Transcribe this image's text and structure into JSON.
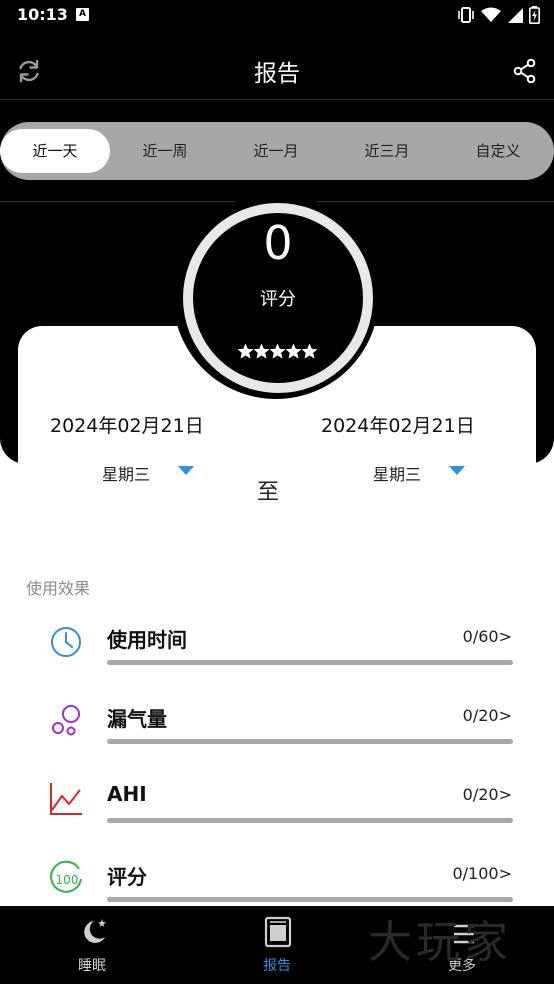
{
  "status_bar": {
    "time": "10:13",
    "notification_letter": "A"
  },
  "header": {
    "title": "报告"
  },
  "tabs": [
    {
      "label": "近一天",
      "active": true
    },
    {
      "label": "近一周",
      "active": false
    },
    {
      "label": "近一月",
      "active": false
    },
    {
      "label": "近三月",
      "active": false
    },
    {
      "label": "自定义",
      "active": false
    }
  ],
  "score": {
    "value": "0",
    "label": "评分",
    "stars_total": 5,
    "stars_filled": 5
  },
  "date_range": {
    "start_date": "2024年02月21日",
    "start_weekday": "星期三",
    "end_date": "2024年02月21日",
    "end_weekday": "星期三",
    "separator": "至"
  },
  "section": {
    "title": "使用效果"
  },
  "metrics": [
    {
      "name": "使用时间",
      "value": "0/60>",
      "progress": 0,
      "icon": "clock-icon",
      "color": "#2f8fe0"
    },
    {
      "name": "漏气量",
      "value": "0/20>",
      "progress": 0,
      "icon": "bubbles-icon",
      "color": "#9b30c9"
    },
    {
      "name": "AHI",
      "value": "0/20>",
      "progress": 0,
      "icon": "line-chart-icon",
      "color": "#d8262e"
    },
    {
      "name": "评分",
      "value": "0/100>",
      "progress": 0,
      "icon": "score-100-icon",
      "color": "#2fb54a",
      "icon_text": "100"
    }
  ],
  "bottom_nav": [
    {
      "label": "睡眠",
      "active": false,
      "icon": "moon-star-icon"
    },
    {
      "label": "报告",
      "active": true,
      "icon": "report-icon"
    },
    {
      "label": "更多",
      "active": false,
      "icon": "menu-icon"
    }
  ],
  "watermark": {
    "text": "大玩家"
  },
  "colors": {
    "accent": "#2f8fe0",
    "bar_track": "#a9a9a9",
    "background_dark": "#000000"
  }
}
